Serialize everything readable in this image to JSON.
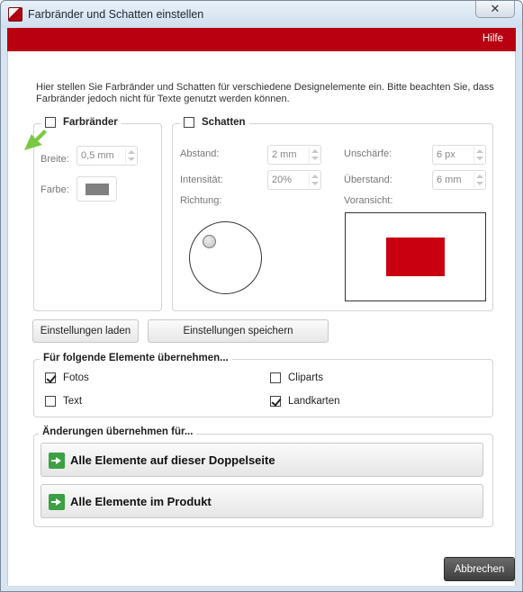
{
  "window": {
    "title": "Farbränder und Schatten einstellen",
    "close_symbol": "✕",
    "help": "Hilfe"
  },
  "intro": "Hier stellen Sie Farbränder und Schatten für verschiedene Designelemente ein. Bitte beachten Sie, dass Farbränder jedoch nicht für Texte genutzt werden können.",
  "farbraender": {
    "label": "Farbränder",
    "checked": false,
    "breite_label": "Breite:",
    "breite_value": "0,5 mm",
    "farbe_label": "Farbe:",
    "farbe_color": "#808080"
  },
  "schatten": {
    "label": "Schatten",
    "checked": false,
    "abstand_label": "Abstand:",
    "abstand_value": "2 mm",
    "intensitaet_label": "Intensität:",
    "intensitaet_value": "20%",
    "richtung_label": "Richtung:",
    "unschaerfe_label": "Unschärfe:",
    "unschaerfe_value": "6 px",
    "ueberstand_label": "Überstand:",
    "ueberstand_value": "6 mm",
    "voransicht_label": "Voransicht:",
    "preview_color": "#c8000f"
  },
  "buttons": {
    "load": "Einstellungen laden",
    "save": "Einstellungen speichern",
    "cancel": "Abbrechen"
  },
  "elements": {
    "legend": "Für folgende Elemente übernehmen...",
    "items": [
      {
        "label": "Fotos",
        "checked": true
      },
      {
        "label": "Cliparts",
        "checked": false
      },
      {
        "label": "Text",
        "checked": false
      },
      {
        "label": "Landkarten",
        "checked": true
      }
    ]
  },
  "apply": {
    "legend": "Änderungen übernehmen für...",
    "spread": "Alle Elemente auf dieser Doppelseite",
    "product": "Alle Elemente im Produkt"
  },
  "colors": {
    "accent_red": "#b80010",
    "hint_green": "#7ac943"
  }
}
